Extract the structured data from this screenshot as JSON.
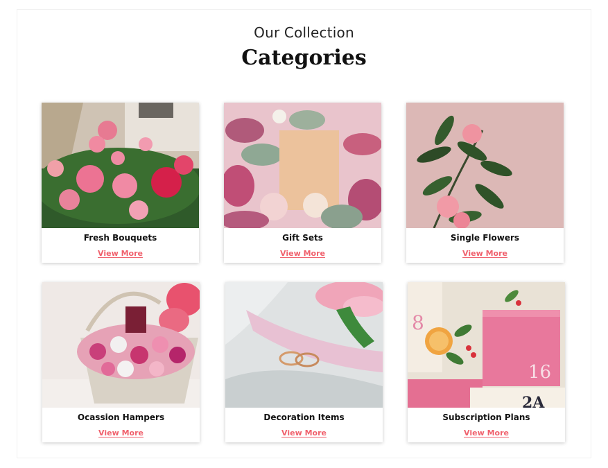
{
  "section": {
    "kicker": "Our Collection",
    "title": "Categories"
  },
  "categories": [
    {
      "name": "Fresh Bouquets",
      "link": "View More"
    },
    {
      "name": "Gift Sets",
      "link": "View More"
    },
    {
      "name": "Single Flowers",
      "link": "View More"
    },
    {
      "name": "Ocassion Hampers",
      "link": "View More"
    },
    {
      "name": "Decoration Items",
      "link": "View More"
    },
    {
      "name": "Subscription Plans",
      "link": "View More"
    }
  ],
  "image_text": {
    "numeral_8": "8",
    "numeral_16": "16"
  },
  "colors": {
    "link": "#f0616d",
    "accent_pink": "#e6789c"
  }
}
